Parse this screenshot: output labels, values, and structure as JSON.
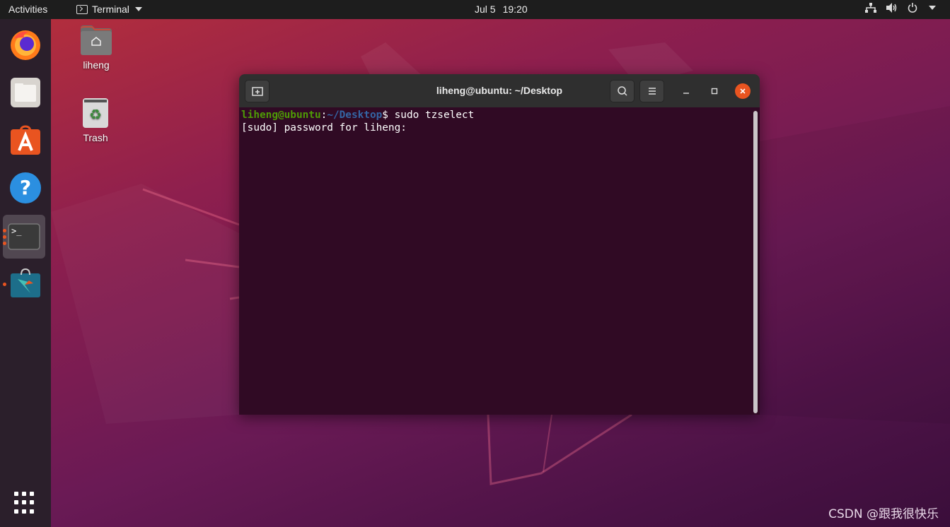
{
  "topbar": {
    "activities": "Activities",
    "app_menu": "Terminal",
    "date": "Jul 5",
    "time": "19:20",
    "tray_icons": [
      "network-icon",
      "volume-icon",
      "power-icon"
    ]
  },
  "dock": {
    "items": [
      {
        "name": "firefox",
        "icon": "firefox-icon"
      },
      {
        "name": "files",
        "icon": "files-icon"
      },
      {
        "name": "software",
        "icon": "software-center-icon"
      },
      {
        "name": "help",
        "icon": "help-icon"
      },
      {
        "name": "terminal",
        "icon": "terminal-icon",
        "active": true
      },
      {
        "name": "store",
        "icon": "snap-store-icon"
      }
    ],
    "show_apps_icon": "app-grid-icon"
  },
  "desktop": {
    "icons": [
      {
        "label": "liheng",
        "icon": "home-folder-icon"
      },
      {
        "label": "Trash",
        "icon": "trash-icon"
      }
    ]
  },
  "terminal": {
    "title": "liheng@ubuntu: ~/Desktop",
    "lines": [
      {
        "user": "liheng@ubuntu",
        "sep": ":",
        "path": "~/Desktop",
        "dollar": "$",
        "command": " sudo tzselect"
      },
      {
        "text": "[sudo] password for liheng: "
      }
    ]
  },
  "watermark": "CSDN @跟我很快乐",
  "colors": {
    "accent": "#e95420",
    "terminal_bg": "#300a24",
    "prompt_user": "#4e9a06",
    "prompt_path": "#3465a4"
  }
}
